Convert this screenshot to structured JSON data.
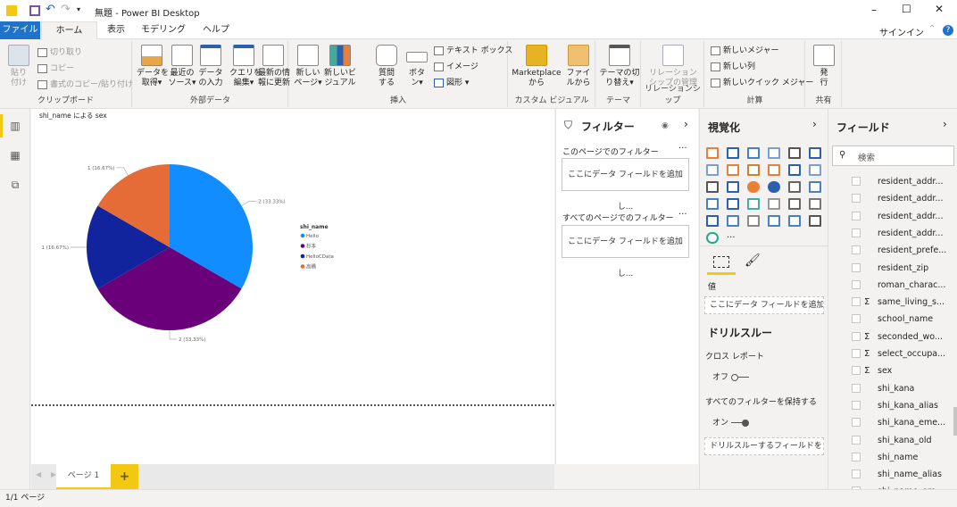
{
  "window": {
    "title": "無題 - Power BI Desktop",
    "minimize": "–",
    "maximize": "☐",
    "close": "✕",
    "sign_in": "サインイン"
  },
  "tabs": [
    {
      "label": "ファイル"
    },
    {
      "label": "ホーム"
    },
    {
      "label": "表示"
    },
    {
      "label": "モデリング"
    },
    {
      "label": "ヘルプ"
    }
  ],
  "ribbon": {
    "clipboard": {
      "label": "クリップボード",
      "paste": "貼り\n付け",
      "cut": "切り取り",
      "copy": "コピー",
      "format_painter": "書式のコピー/貼り付け"
    },
    "external": {
      "label": "外部データ",
      "get_data": "データを\n取得▾",
      "recent": "最近の\nソース▾",
      "enter": "データ\nの入力",
      "edit_query": "クエリを\n編集▾",
      "refresh": "最新の情\n報に更新"
    },
    "insert": {
      "label": "挿入",
      "new_page": "新しい\nページ▾",
      "new_visual": "新しいビ\nジュアル",
      "ask": "質問\nする",
      "buttons": "ボタ\nン▾",
      "textbox": "テキスト ボックス",
      "image": "イメージ",
      "shapes": "図形 ▾"
    },
    "custom": {
      "label": "カスタム ビジュアル",
      "marketplace": "Marketplace\nから",
      "file": "ファイ\nルから"
    },
    "theme": {
      "label": "テーマ",
      "switch": "テーマの切\nり替え▾"
    },
    "relation": {
      "label": "リレーションシップ",
      "manage": "リレーション\nシップの管理"
    },
    "calc": {
      "label": "計算",
      "measure": "新しいメジャー",
      "column": "新しい列",
      "quick": "新しいクイック メジャー"
    },
    "share": {
      "label": "共有",
      "publish": "発\n行"
    }
  },
  "chart_data": {
    "type": "pie",
    "title": "shi_name による sex",
    "legend_title": "shi_name",
    "legend_position": "right",
    "categories": [
      "Hello",
      "杉本",
      "HelloCData",
      "高橋"
    ],
    "values": [
      2,
      2,
      1,
      1
    ],
    "labels": [
      "2 (33.33%)",
      "2 (33.33%)",
      "1 (16.67%)",
      "1 (16.67%)"
    ],
    "colors": [
      "#118DFF",
      "#6B007B",
      "#12239E",
      "#E66C37"
    ]
  },
  "pages": {
    "tab": "ページ 1",
    "add": "+",
    "status": "1/1 ページ"
  },
  "filters": {
    "title": "フィルター",
    "page_label": "このページでのフィルター",
    "page_well": "ここにデータ フィールドを追加し...",
    "all_label": "すべてのページでのフィルター",
    "all_well": "ここにデータ フィールドを追加し...",
    "more": "···"
  },
  "viz": {
    "title": "視覚化",
    "more": "···",
    "values_label": "値",
    "values_well": "ここにデータ フィールドを追加して...",
    "drill_title": "ドリルスルー",
    "cross_report": "クロス レポート",
    "cross_state": "オフ",
    "keep_filters": "すべてのフィルターを保持する",
    "keep_state": "オン",
    "drill_well": "ドリルスルーするフィールドをここ..."
  },
  "fields": {
    "title": "フィールド",
    "search_placeholder": "検索",
    "items": [
      {
        "name": "resident_addr...",
        "sigma": ""
      },
      {
        "name": "resident_addr...",
        "sigma": ""
      },
      {
        "name": "resident_addr...",
        "sigma": ""
      },
      {
        "name": "resident_addr...",
        "sigma": ""
      },
      {
        "name": "resident_prefe...",
        "sigma": ""
      },
      {
        "name": "resident_zip",
        "sigma": ""
      },
      {
        "name": "roman_charac...",
        "sigma": ""
      },
      {
        "name": "same_living_s...",
        "sigma": "Σ"
      },
      {
        "name": "school_name",
        "sigma": ""
      },
      {
        "name": "seconded_wo...",
        "sigma": "Σ"
      },
      {
        "name": "select_occupa...",
        "sigma": "Σ"
      },
      {
        "name": "sex",
        "sigma": "Σ"
      },
      {
        "name": "shi_kana",
        "sigma": ""
      },
      {
        "name": "shi_kana_alias",
        "sigma": ""
      },
      {
        "name": "shi_kana_eme...",
        "sigma": ""
      },
      {
        "name": "shi_kana_old",
        "sigma": ""
      },
      {
        "name": "shi_name",
        "sigma": ""
      },
      {
        "name": "shi_name_alias",
        "sigma": ""
      },
      {
        "name": "shi_name_em",
        "sigma": ""
      }
    ]
  }
}
